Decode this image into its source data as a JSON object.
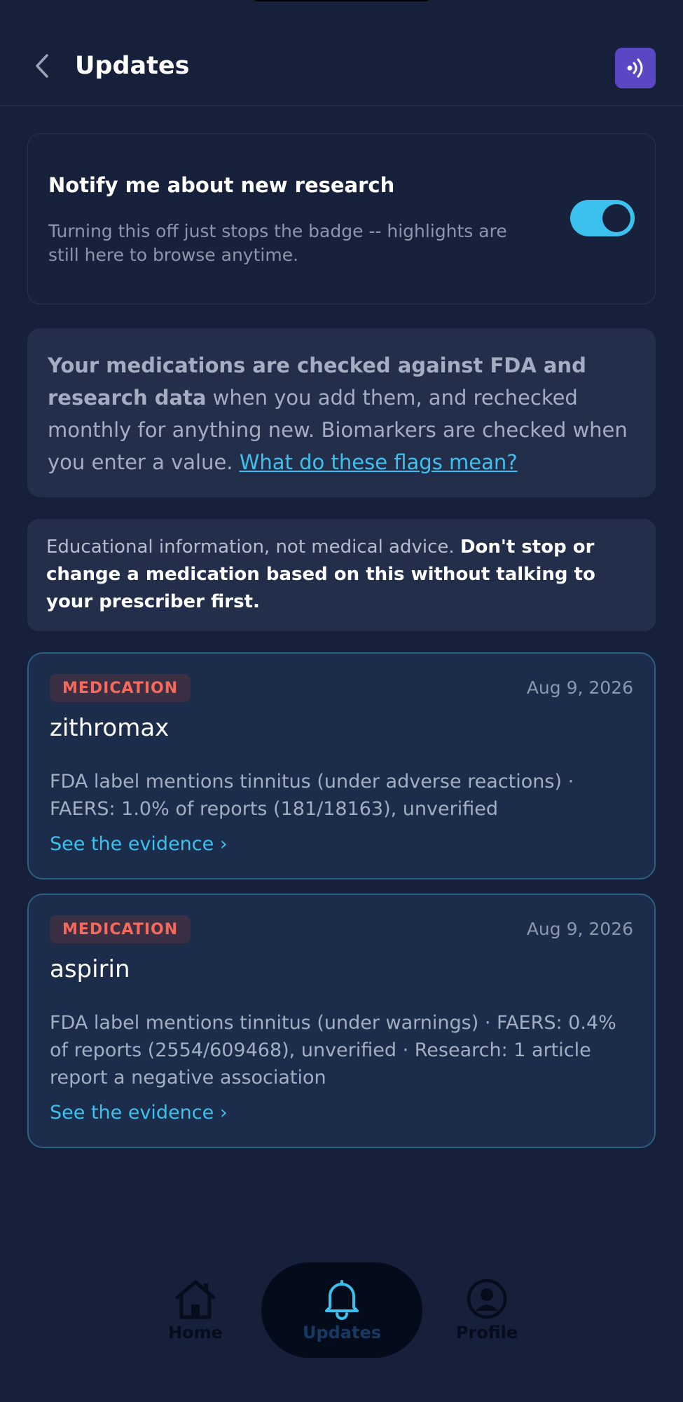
{
  "header": {
    "title": "Updates",
    "back_icon": "chevron-left-icon",
    "action_icon": "audio-icon"
  },
  "notify": {
    "title": "Notify me about new research",
    "description": "Turning this off just stops the badge -- highlights are still here to browse anytime.",
    "enabled": true
  },
  "info": {
    "bold": "Your medications are checked against FDA and research data",
    "text": " when you add them, and rechecked monthly for anything new. Biomarkers are checked when you enter a value. ",
    "link": "What do these flags mean?"
  },
  "disclaimer": {
    "text": "Educational information, not medical advice. ",
    "bold": "Don't stop or change a medication based on this without talking to your prescriber first."
  },
  "cards": [
    {
      "badge": "MEDICATION",
      "date": "Aug 9, 2026",
      "name": "zithromax",
      "description": "FDA label mentions tinnitus (under adverse reactions) · FAERS: 1.0% of reports (181/18163), unverified",
      "link": "See the evidence ›"
    },
    {
      "badge": "MEDICATION",
      "date": "Aug 9, 2026",
      "name": "aspirin",
      "description": "FDA label mentions tinnitus (under warnings) · FAERS: 0.4% of reports (2554/609468), unverified · Research: 1 article report a negative association",
      "link": "See the evidence ›"
    }
  ],
  "nav": {
    "items": [
      {
        "label": "Home",
        "icon": "home-icon"
      },
      {
        "label": "Updates",
        "icon": "bell-icon",
        "active": true
      },
      {
        "label": "Profile",
        "icon": "profile-icon"
      }
    ]
  },
  "colors": {
    "background": "#16203a",
    "accent": "#3cc1ee",
    "badge_text": "#f56a5c",
    "action_button": "#5b46c4"
  }
}
